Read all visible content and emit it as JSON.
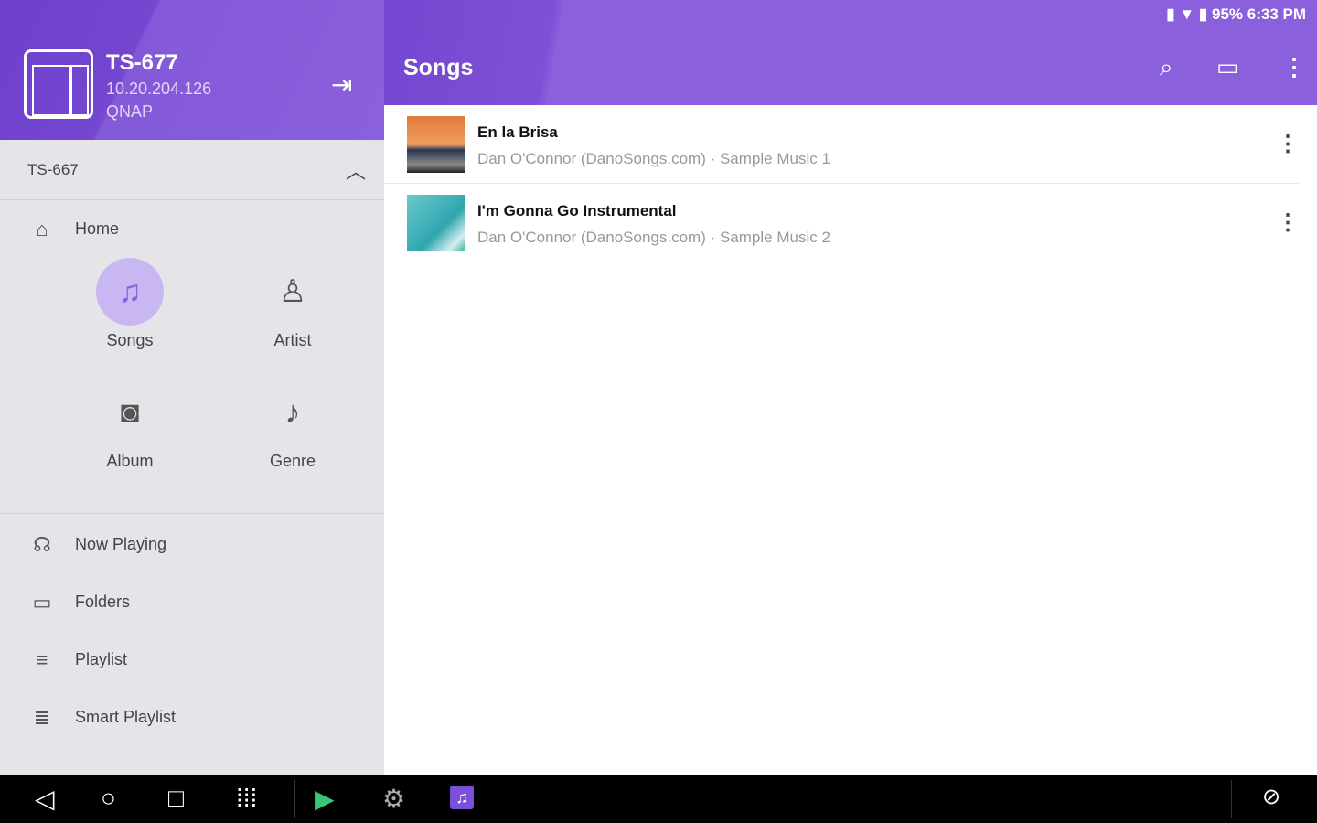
{
  "status": {
    "battery": "95%",
    "time": "6:33 PM"
  },
  "drawer": {
    "device_name": "TS-677",
    "ip": "10.20.204.126",
    "brand": "QNAP",
    "selected_server": "TS-667",
    "home": "Home",
    "categories": [
      {
        "label": "Songs"
      },
      {
        "label": "Artist"
      },
      {
        "label": "Album"
      },
      {
        "label": "Genre"
      }
    ],
    "items": [
      {
        "label": "Now Playing"
      },
      {
        "label": "Folders"
      },
      {
        "label": "Playlist"
      },
      {
        "label": "Smart Playlist"
      }
    ]
  },
  "appbar": {
    "title": "Songs"
  },
  "songs": [
    {
      "title": "En la Brisa",
      "subtitle": "Dan O'Connor (DanoSongs.com) · Sample Music 1"
    },
    {
      "title": "I'm Gonna Go Instrumental",
      "subtitle": "Dan O'Connor (DanoSongs.com) · Sample Music 2"
    }
  ]
}
